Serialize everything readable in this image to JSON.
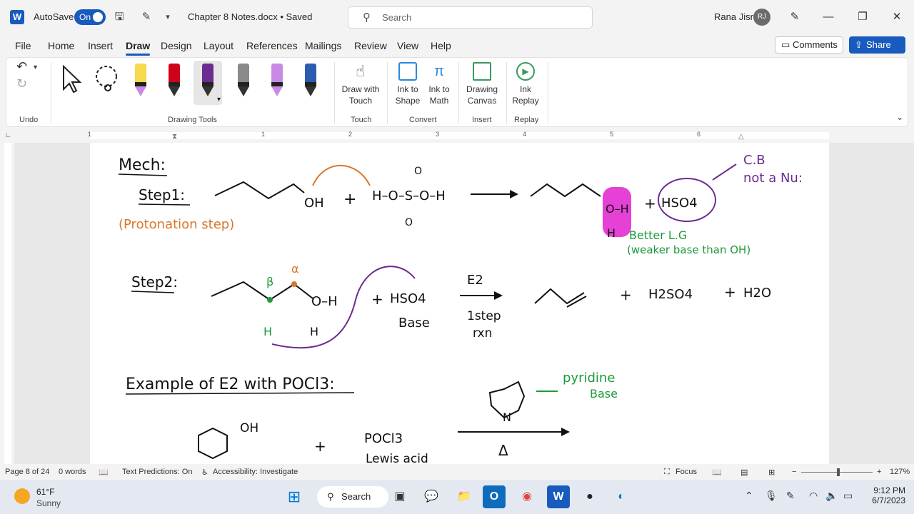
{
  "titlebar": {
    "autosave_label": "AutoSave",
    "autosave_state": "On",
    "doc_title": "Chapter 8 Notes.docx • Saved",
    "search_placeholder": "Search",
    "user_name": "Rana Jisr",
    "user_initials": "RJ"
  },
  "menu": {
    "tabs": [
      "File",
      "Home",
      "Insert",
      "Draw",
      "Design",
      "Layout",
      "References",
      "Mailings",
      "Review",
      "View",
      "Help"
    ],
    "active_tab": "Draw",
    "comments_label": "Comments",
    "share_label": "Share"
  },
  "ribbon": {
    "groups": {
      "undo": "Undo",
      "drawing_tools": "Drawing Tools",
      "touch": "Touch",
      "convert": "Convert",
      "insert": "Insert",
      "replay": "Replay"
    },
    "buttons": {
      "draw_with_touch_1": "Draw with",
      "draw_with_touch_2": "Touch",
      "ink_to_shape_1": "Ink to",
      "ink_to_shape_2": "Shape",
      "ink_to_math_1": "Ink to",
      "ink_to_math_2": "Math",
      "drawing_canvas_1": "Drawing",
      "drawing_canvas_2": "Canvas",
      "ink_replay_1": "Ink",
      "ink_replay_2": "Replay"
    },
    "pens": [
      {
        "name": "highlighter-yellow",
        "color": "#f7d94c"
      },
      {
        "name": "pen-red",
        "color": "#d0021b"
      },
      {
        "name": "pen-purple",
        "color": "#6a2c91"
      },
      {
        "name": "pen-gray",
        "color": "#8a8a8a"
      },
      {
        "name": "highlighter-violet",
        "color": "#c98ae6"
      },
      {
        "name": "pen-galaxy",
        "color": "#2a5db0"
      }
    ]
  },
  "ruler": {
    "numbers": [
      "1",
      "1",
      "2",
      "3",
      "4",
      "5",
      "6"
    ]
  },
  "notes": {
    "heading": "Mech:",
    "step1": "Step1:",
    "protonation": "(Protonation step)",
    "oh1": "OH",
    "plus": "+",
    "acid": "H–O–S–O–H",
    "s_top": "O",
    "s_bottom": "O",
    "product1_oh": "O–H",
    "product1_h": "H",
    "hso4": "HSO4",
    "cb_label": "C.B",
    "not_nu": "not a Nu:",
    "better_lg": "Better L.G",
    "weaker_base": "(weaker base than OH)",
    "step2": "Step2:",
    "beta": "β",
    "alpha": "α",
    "o_h": "O–H",
    "h_bottom": "H",
    "h_beta": "H",
    "hso4_base": "HSO4",
    "base_word": "Base",
    "e2": "E2",
    "one_step": "1step",
    "rxn": "rxn",
    "h2so4": "H2SO4",
    "h2o": "H2O",
    "example": "Example of E2 with POCl3:",
    "pyridine": "pyridine",
    "pyr_base": "Base",
    "pyr_n": "N",
    "oh2": "OH",
    "pocl3": "POCl3",
    "lewis": "Lewis acid",
    "delta": "Δ"
  },
  "status": {
    "page": "Page 8 of 24",
    "words": "0 words",
    "text_predictions": "Text Predictions: On",
    "accessibility": "Accessibility: Investigate",
    "focus": "Focus",
    "zoom": "127%"
  },
  "taskbar": {
    "temp": "61°F",
    "condition": "Sunny",
    "search_label": "Search",
    "time": "9:12 PM",
    "date": "6/7/2023"
  },
  "colors": {
    "accent": "#185abd",
    "ink_black": "#111111",
    "ink_orange": "#d9762b",
    "ink_purple": "#6a2c91",
    "ink_green": "#1f9a3a",
    "ink_magenta": "#e020d0"
  }
}
